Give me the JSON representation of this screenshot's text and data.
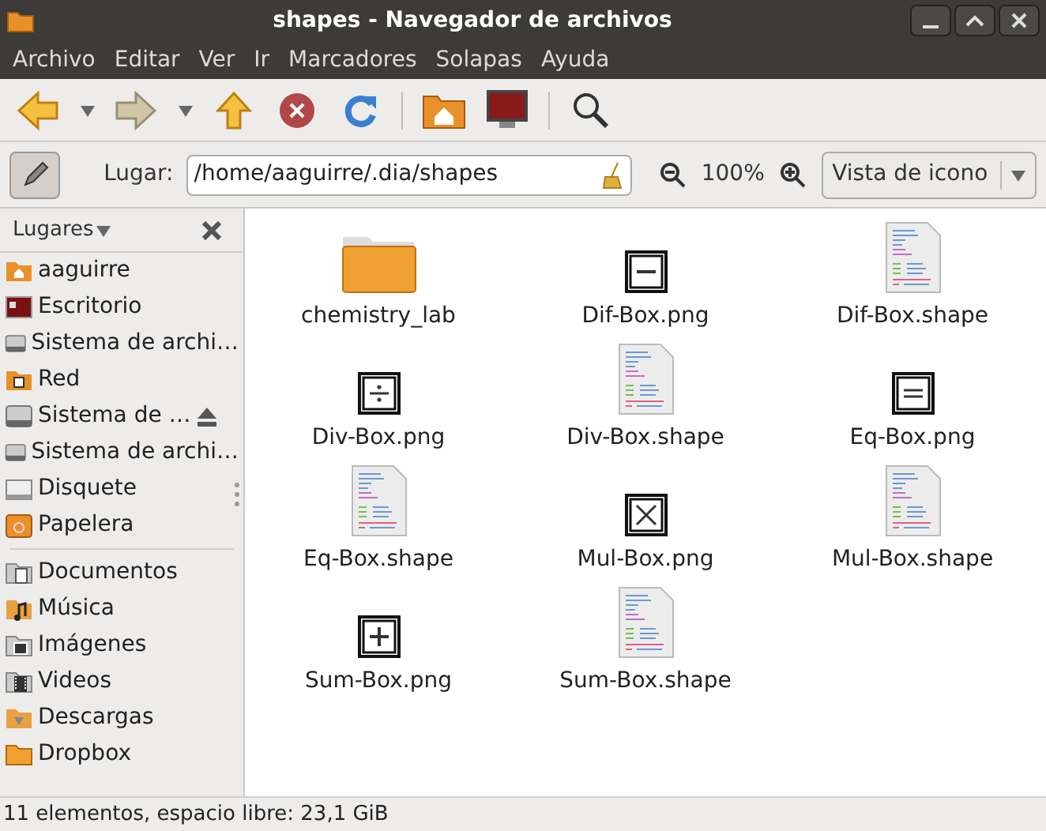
{
  "window": {
    "title": "shapes - Navegador de archivos"
  },
  "menu": [
    "Archivo",
    "Editar",
    "Ver",
    "Ir",
    "Marcadores",
    "Solapas",
    "Ayuda"
  ],
  "toolbar": [
    {
      "kind": "back"
    },
    {
      "kind": "dropdown"
    },
    {
      "kind": "forward"
    },
    {
      "kind": "dropdown"
    },
    {
      "kind": "up"
    },
    {
      "kind": "stop"
    },
    {
      "kind": "reload"
    },
    {
      "kind": "separator"
    },
    {
      "kind": "home"
    },
    {
      "kind": "computer"
    },
    {
      "kind": "separator"
    },
    {
      "kind": "search"
    }
  ],
  "location": {
    "label": "Lugar:",
    "value": "/home/aaguirre/.dia/shapes",
    "zoom": "100%",
    "view": "Vista de icono"
  },
  "sidebar": {
    "title": "Lugares",
    "groups": [
      [
        {
          "label": "aaguirre",
          "kind": "home",
          "eject": false
        },
        {
          "label": "Escritorio",
          "kind": "desktop",
          "eject": false
        },
        {
          "label": "Sistema de archi…",
          "kind": "drive",
          "eject": false
        },
        {
          "label": "Red",
          "kind": "network",
          "eject": false
        },
        {
          "label": "Sistema de …",
          "kind": "drive",
          "eject": true
        },
        {
          "label": "Sistema de archi…",
          "kind": "drive",
          "eject": false
        },
        {
          "label": "Disquete",
          "kind": "floppy",
          "eject": false
        },
        {
          "label": "Papelera",
          "kind": "trash",
          "eject": false
        }
      ],
      [
        {
          "label": "Documentos",
          "kind": "documents",
          "eject": false
        },
        {
          "label": "Música",
          "kind": "music",
          "eject": false
        },
        {
          "label": "Imágenes",
          "kind": "pictures",
          "eject": false
        },
        {
          "label": "Videos",
          "kind": "videos",
          "eject": false
        },
        {
          "label": "Descargas",
          "kind": "downloads",
          "eject": false
        },
        {
          "label": "Dropbox",
          "kind": "folder",
          "eject": false
        }
      ]
    ]
  },
  "files": [
    {
      "name": "chemistry_lab",
      "kind": "folder"
    },
    {
      "name": "Dif-Box.png",
      "kind": "minus-box"
    },
    {
      "name": "Dif-Box.shape",
      "kind": "shape-file"
    },
    {
      "name": "Div-Box.png",
      "kind": "divide-box"
    },
    {
      "name": "Div-Box.shape",
      "kind": "shape-file"
    },
    {
      "name": "Eq-Box.png",
      "kind": "equals-box"
    },
    {
      "name": "Eq-Box.shape",
      "kind": "shape-file"
    },
    {
      "name": "Mul-Box.png",
      "kind": "times-box"
    },
    {
      "name": "Mul-Box.shape",
      "kind": "shape-file"
    },
    {
      "name": "Sum-Box.png",
      "kind": "plus-box"
    },
    {
      "name": "Sum-Box.shape",
      "kind": "shape-file"
    }
  ],
  "status_bar": "11 elementos, espacio libre: 23,1 GiB"
}
